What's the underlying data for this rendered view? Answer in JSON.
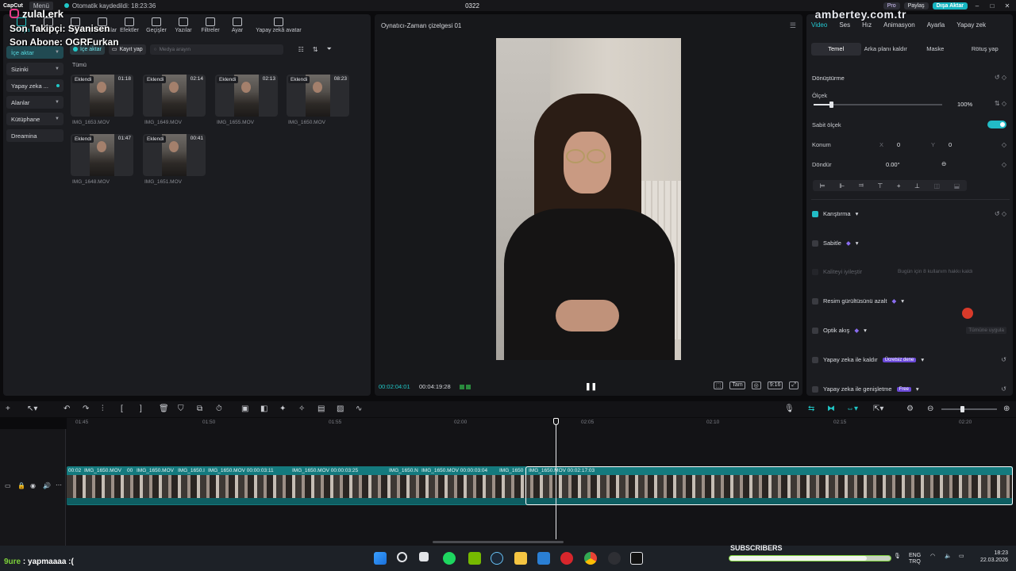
{
  "topbar": {
    "app_name": "CapCut",
    "menu_label": "Menü",
    "autosave": "Otomatik kaydedildi: 18:23:36",
    "project_title": "0322",
    "pro_label": "Pro",
    "share_label": "Paylaş",
    "export_label": "Dışa Aktar"
  },
  "overlay": {
    "instagram_handle": "zulal.erk",
    "last_follower": "Son Takipçi: Syanisen",
    "last_subscriber": "Son Abone: OGRFurkan",
    "watermark": "ambertey.com.tr"
  },
  "toolbar": {
    "items": [
      "Medya",
      "Ses",
      "Metin",
      "Çıkartmalar",
      "Efektler",
      "Geçişler",
      "Yazılar",
      "Filtreler",
      "Ayar",
      "Yapay zekâ avatar"
    ]
  },
  "sidenav": {
    "items": [
      {
        "label": "İçe aktar"
      },
      {
        "label": "Sizinki"
      },
      {
        "label": "Yapay zeka ..."
      },
      {
        "label": "Alanlar"
      },
      {
        "label": "Kütüphane"
      },
      {
        "label": "Dreamina"
      }
    ]
  },
  "media": {
    "import_label": "İçe aktar",
    "record_label": "Kayıt yap",
    "search_placeholder": "Medya arayın",
    "section_label": "Tümü",
    "clips": [
      {
        "badge": "Eklendi",
        "duration": "01:18",
        "name": "IMG_1653.MOV"
      },
      {
        "badge": "Eklendi",
        "duration": "02:14",
        "name": "IMG_1649.MOV"
      },
      {
        "badge": "Eklendi",
        "duration": "02:13",
        "name": "IMG_1655.MOV"
      },
      {
        "badge": "Eklendi",
        "duration": "08:23",
        "name": "IMG_1650.MOV"
      },
      {
        "badge": "Eklendi",
        "duration": "01:47",
        "name": "IMG_1648.MOV"
      },
      {
        "badge": "Eklendi",
        "duration": "00:41",
        "name": "IMG_1651.MOV"
      }
    ]
  },
  "player": {
    "title": "Oynatıcı-Zaman çizelgesi 01",
    "current_time": "00:02:04:01",
    "total_time": "00:04:19:28",
    "full_label": "Tam",
    "ratio_label": "9:16"
  },
  "inspector": {
    "tabs": [
      "Video",
      "Ses",
      "Hız",
      "Animasyon",
      "Ayarla",
      "Yapay zek"
    ],
    "subtabs": [
      "Temel",
      "Arka planı kaldır",
      "Maske",
      "Rötuş yap"
    ],
    "transform_title": "Dönüştürme",
    "scale_label": "Ölçek",
    "scale_value": "100%",
    "scale_level": 0.14,
    "uniform_scale_label": "Sabit ölçek",
    "position_label": "Konum",
    "pos_x_label": "X",
    "pos_x": "0",
    "pos_y_label": "Y",
    "pos_y": "0",
    "rotate_label": "Döndür",
    "rotate_value": "0.00°",
    "blend_label": "Karıştırma",
    "stabilize_label": "Sabitle",
    "quality_label": "Kaliteyi iyileştir",
    "quality_note": "Bugün için 8 kullanım hakkı kaldı",
    "denoise_label": "Resim gürültüsünü azalt",
    "optical_label": "Optik akış",
    "apply_all_label": "Tümüne uygula",
    "ai_remove_label": "Yapay zeka ile kaldır",
    "ai_remove_badge": "Ücretsiz dene",
    "ai_expand_label": "Yapay zeka ile genişletme",
    "ai_expand_badge": "Free"
  },
  "timeline": {
    "ruler": [
      "01:45",
      "01:50",
      "01:55",
      "02:00",
      "02:05",
      "02:10",
      "02:15",
      "02:20"
    ],
    "clip_labels": [
      "00:02",
      "IMG_1650.MOV",
      "00",
      "IMG_1650.MOV",
      "IMG_1650.I",
      "IMG_1650.MOV  00:00:03:11",
      "IMG_1650.MOV  00:00:03:25",
      "IMG_1650.N",
      "IMG_1650.MOV  00:00:03:04",
      "IMG_1650",
      "IMG_1650.MOV  00:02:17:03"
    ]
  },
  "taskbar": {
    "left_text_a": "9ure",
    "left_text_b": " : yapmaaaa :(",
    "subscribers_label": "SUBSCRIBERS",
    "subscribers_progress": 0.85,
    "lang_a": "ENG",
    "lang_b": "TRQ",
    "time": "18:23",
    "date": "22.03.2026"
  }
}
